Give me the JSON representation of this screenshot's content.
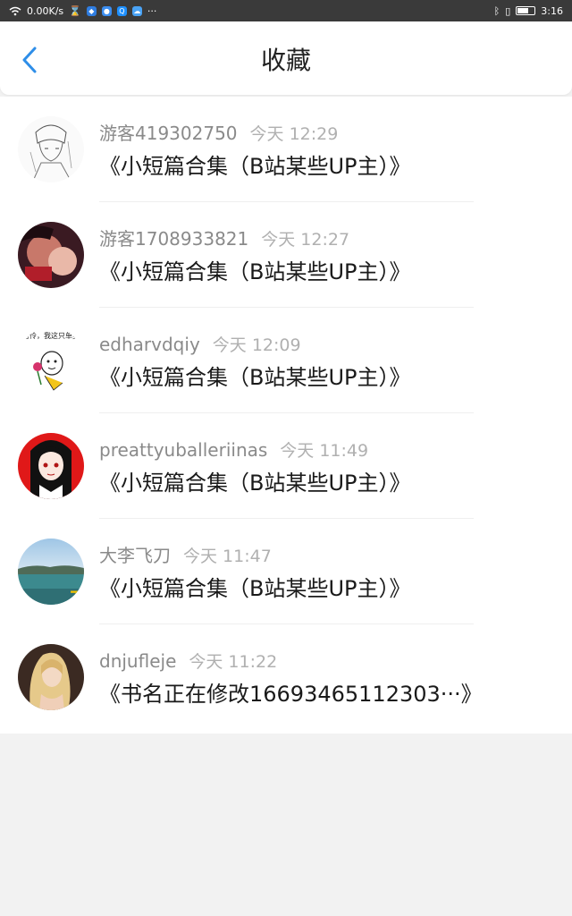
{
  "status_bar": {
    "net_speed": "0.00K/s",
    "extra": "···",
    "time": "3:16",
    "battery_level": 0.65
  },
  "header": {
    "title": "收藏",
    "back_icon": "chevron-left-icon",
    "accent_color": "#2e8ee8"
  },
  "items": [
    {
      "user": "游客419302750",
      "time": "今天 12:29",
      "book": "《小短篇合集（B站某些UP主）》"
    },
    {
      "user": "游客1708933821",
      "time": "今天 12:27",
      "book": "《小短篇合集（B站某些UP主）》"
    },
    {
      "user": "edharvdqiy",
      "time": "今天 12:09",
      "book": "《小短篇合集（B站某些UP主）》",
      "avatar_text": "又花可怜，我这只单身狗！"
    },
    {
      "user": "preattyuballeriinas",
      "time": "今天 11:49",
      "book": "《小短篇合集（B站某些UP主）》"
    },
    {
      "user": "大李飞刀",
      "time": "今天 11:47",
      "book": "《小短篇合集（B站某些UP主）》"
    },
    {
      "user": "dnjufleje",
      "time": "今天 11:22",
      "book": "《书名正在修改16693465112303···》"
    }
  ]
}
